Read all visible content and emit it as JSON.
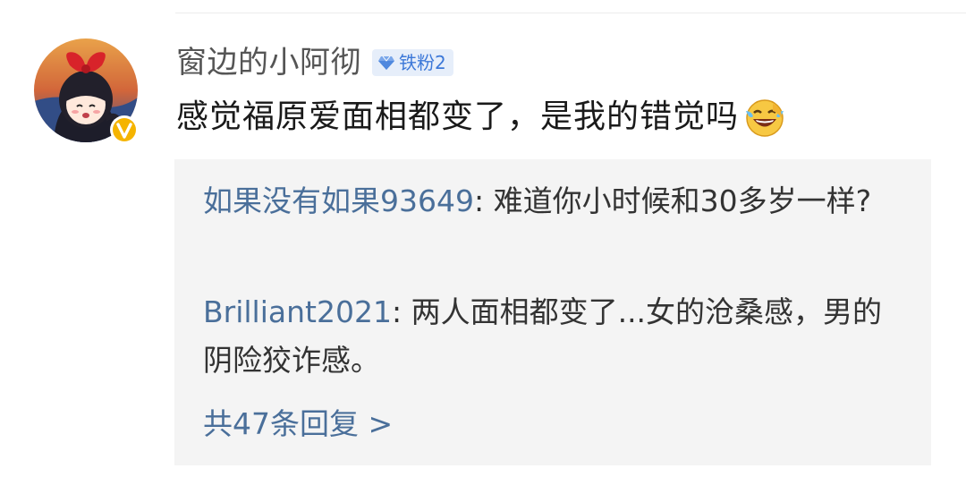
{
  "comment": {
    "username": "窗边的小阿彻",
    "badge": {
      "icon": "diamond-icon",
      "label": "铁粉2"
    },
    "text": "感觉福原爱面相都变了，是我的错觉吗",
    "emoji": "laughing-crying-emoji-icon",
    "avatar_badge_icon": "verified-v-icon"
  },
  "replies": [
    {
      "author": "如果没有如果93649",
      "separator": ":",
      "text": "难道你小时候和30多岁一样?"
    },
    {
      "author": "Brilliant2021",
      "separator": ":",
      "text": "两人面相都变了...女的沧桑感，男的阴险狡诈感。"
    }
  ],
  "more_replies": "共47条回复 >",
  "colors": {
    "link": "#4a6f9a",
    "badge_bg": "#e6eefa",
    "badge_text": "#3c78d8",
    "verified": "#f5b400",
    "reply_bg": "#f4f4f4"
  }
}
